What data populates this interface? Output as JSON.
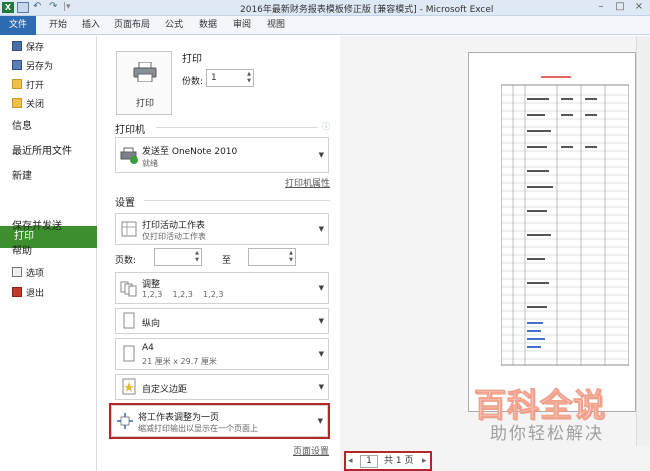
{
  "window": {
    "title": "2016年最新财务报表模板修正版 [兼容模式] - Microsoft Excel",
    "minimize": "–",
    "maximize": "□",
    "close": "×"
  },
  "ribbon_tabs": [
    "文件",
    "开始",
    "插入",
    "页面布局",
    "公式",
    "数据",
    "审阅",
    "视图"
  ],
  "nav": {
    "save": "保存",
    "save_as": "另存为",
    "open": "打开",
    "close": "关闭",
    "info": "信息",
    "recent": "最近所用文件",
    "new": "新建",
    "print": "打印",
    "save_send": "保存并发送",
    "help": "帮助",
    "options": "选项",
    "exit": "退出"
  },
  "print": {
    "header": "打印",
    "button_label": "打印",
    "copies_label": "份数:",
    "copies_value": "1"
  },
  "printer": {
    "header": "打印机",
    "name": "发送至 OneNote 2010",
    "status": "就绪",
    "properties_link": "打印机属性"
  },
  "settings": {
    "header": "设置",
    "what": {
      "title": "打印活动工作表",
      "sub": "仅打印活动工作表"
    },
    "pages_label": "页数:",
    "to_label": "至",
    "collate": {
      "title": "调整",
      "sub": "1,2,3    1,2,3    1,2,3"
    },
    "orientation": {
      "title": "纵向"
    },
    "paper": {
      "title": "A4",
      "sub": "21 厘米 x 29.7 厘米"
    },
    "margins": {
      "title": "自定义边距"
    },
    "scaling": {
      "title": "将工作表调整为一页",
      "sub": "缩减打印输出以显示在一个页面上"
    },
    "page_setup_link": "页面设置"
  },
  "pager": {
    "current": "1",
    "total": "共 1 页"
  },
  "watermark": {
    "main": "百科全说",
    "sub": "助你轻松解决"
  },
  "colors": {
    "file_tab": "#2e6bb1",
    "print_selected": "#3d8f2e",
    "highlight_box": "#b3272a"
  }
}
